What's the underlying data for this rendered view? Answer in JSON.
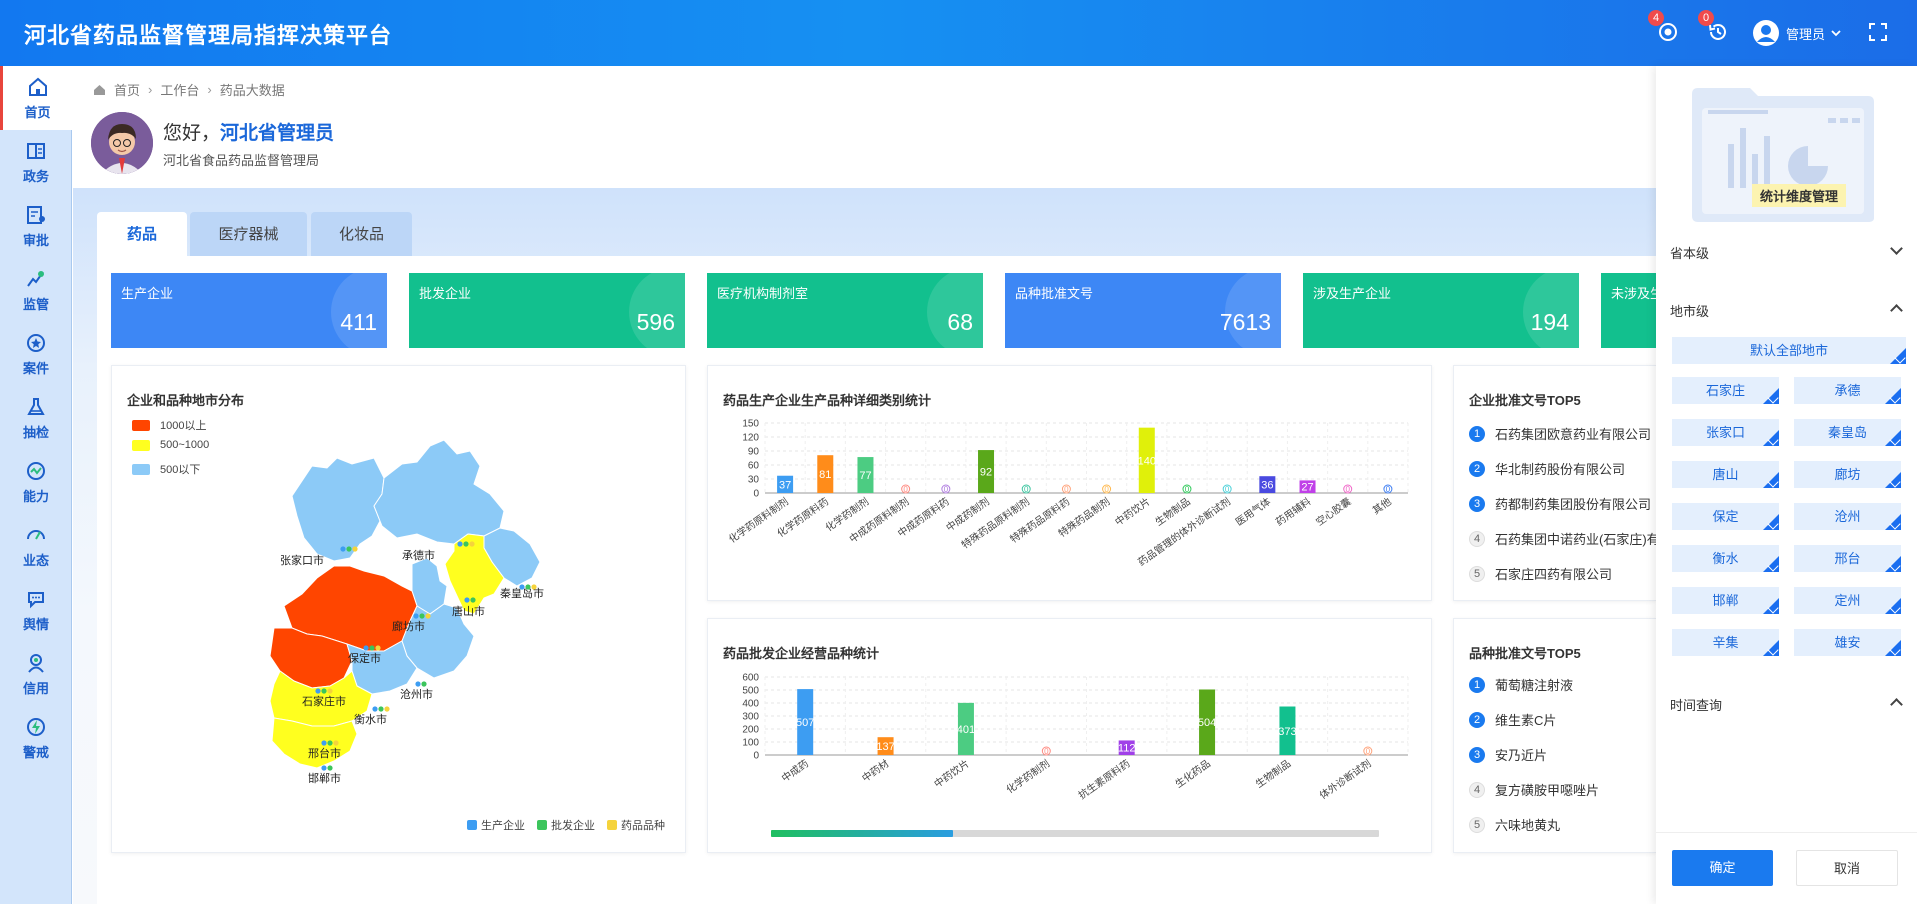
{
  "app": {
    "title": "河北省药品监督管理局指挥决策平台"
  },
  "header": {
    "alerts_badge": "4",
    "history_badge": "0",
    "user_name": "管理员"
  },
  "sidebar": {
    "items": [
      {
        "label": "首页",
        "icon": "home-icon",
        "active": true
      },
      {
        "label": "政务",
        "icon": "gov-affairs-icon"
      },
      {
        "label": "审批",
        "icon": "approval-icon"
      },
      {
        "label": "监管",
        "icon": "supervision-icon"
      },
      {
        "label": "案件",
        "icon": "case-icon"
      },
      {
        "label": "抽检",
        "icon": "sampling-flask-icon"
      },
      {
        "label": "能力",
        "icon": "ability-icon"
      },
      {
        "label": "业态",
        "icon": "business-gauge-icon"
      },
      {
        "label": "舆情",
        "icon": "public-opinion-icon"
      },
      {
        "label": "信用",
        "icon": "credit-icon"
      },
      {
        "label": "警戒",
        "icon": "alert-icon"
      }
    ]
  },
  "breadcrumb": {
    "items": [
      "首页",
      "工作台",
      "药品大数据"
    ]
  },
  "greeting": {
    "hello": "您好，",
    "name": "河北省管理员",
    "org": "河北省食品药品监督管理局"
  },
  "tabs": [
    "药品",
    "医疗器械",
    "化妆品"
  ],
  "stats": [
    {
      "label": "生产企业",
      "value": "411",
      "color": "#3d87f5"
    },
    {
      "label": "批发企业",
      "value": "596",
      "color": "#12c08e"
    },
    {
      "label": "医疗机构制剂室",
      "value": "68",
      "color": "#12c08e"
    },
    {
      "label": "品种批准文号",
      "value": "7613",
      "color": "#3d87f5"
    },
    {
      "label": "涉及生产企业",
      "value": "194",
      "color": "#12c08e"
    },
    {
      "label": "未涉及生",
      "value": "",
      "color": "#12c08e"
    }
  ],
  "map_card": {
    "title": "企业和品种地市分布",
    "legend": [
      {
        "label": "1000以上",
        "color": "#ff4500"
      },
      {
        "label": "500~1000",
        "color": "#ffff1f"
      },
      {
        "label": "500以下",
        "color": "#8ccaf7"
      }
    ],
    "cities": [
      "张家口市",
      "承德市",
      "秦皇岛市",
      "唐山市",
      "廊坊市",
      "保定市",
      "沧州市",
      "石家庄市",
      "衡水市",
      "邢台市",
      "邯郸市"
    ],
    "dot_legend": [
      {
        "label": "生产企业",
        "color": "#3d9df2"
      },
      {
        "label": "批发企业",
        "color": "#3cc55c"
      },
      {
        "label": "药品品种",
        "color": "#f5d33c"
      }
    ]
  },
  "chart_data": [
    {
      "type": "bar",
      "title": "药品生产企业生产品种详细类别统计",
      "categories": [
        "化学药原料制剂",
        "化学药原料药",
        "化学药制剂",
        "中成药原料制剂",
        "中成药原料药",
        "中成药制剂",
        "特殊药品原料制剂",
        "特殊药品原料药",
        "特殊药品制剂",
        "中药饮片",
        "生物制品",
        "药品管理的体外诊断试剂",
        "医用气体",
        "药用辅料",
        "空心胶囊",
        "其他"
      ],
      "values": [
        37,
        81,
        77,
        0,
        0,
        92,
        0,
        0,
        0,
        140,
        0,
        0,
        36,
        27,
        0,
        0
      ],
      "colors": [
        "#3d9df2",
        "#ff8c1a",
        "#4ccc82",
        "#ff8a80",
        "#b07de0",
        "#5aa81a",
        "#3cc5a0",
        "#ffa27a",
        "#ffb84d",
        "#e0f00a",
        "#2fc95a",
        "#4ad0d8",
        "#4a4ae0",
        "#c040e8",
        "#f067c8",
        "#3d7df2"
      ],
      "ylim": [
        0,
        150
      ],
      "yticks": [
        0,
        30,
        60,
        90,
        120,
        150
      ]
    },
    {
      "type": "bar",
      "title": "药品批发企业经营品种统计",
      "categories": [
        "中成药",
        "中药材",
        "中药饮片",
        "化学药制剂",
        "抗生素原料药",
        "生化药品",
        "生物制品",
        "体外诊断试剂"
      ],
      "values": [
        507,
        137,
        401,
        0,
        112,
        504,
        373,
        0
      ],
      "colors": [
        "#3d9df2",
        "#ff8c1a",
        "#4ccc82",
        "#ff8a80",
        "#a040e8",
        "#5aa81a",
        "#12c08e",
        "#ffa27a"
      ],
      "ylim": [
        0,
        600
      ],
      "yticks": [
        0,
        100,
        200,
        300,
        400,
        500,
        600
      ]
    }
  ],
  "rank_enterprise": {
    "title": "企业批准文号TOP5",
    "items": [
      "石药集团欧意药业有限公司",
      "华北制药股份有限公司",
      "药都制药集团股份有限公司",
      "石药集团中诺药业(石家庄)有",
      "石家庄四药有限公司"
    ]
  },
  "rank_variety": {
    "title": "品种批准文号TOP5",
    "items": [
      "葡萄糖注射液",
      "维生素C片",
      "安乃近片",
      "复方磺胺甲噁唑片",
      "六味地黄丸"
    ]
  },
  "right_panel": {
    "banner": "统计维度管理",
    "provincial": "省本级",
    "municipal": "地市级",
    "default_all": "默认全部地市",
    "cities": [
      "石家庄",
      "承德",
      "张家口",
      "秦皇岛",
      "唐山",
      "廊坊",
      "保定",
      "沧州",
      "衡水",
      "邢台",
      "邯郸",
      "定州",
      "辛集",
      "雄安"
    ],
    "time_query": "时间查询",
    "confirm": "确定",
    "cancel": "取消"
  }
}
